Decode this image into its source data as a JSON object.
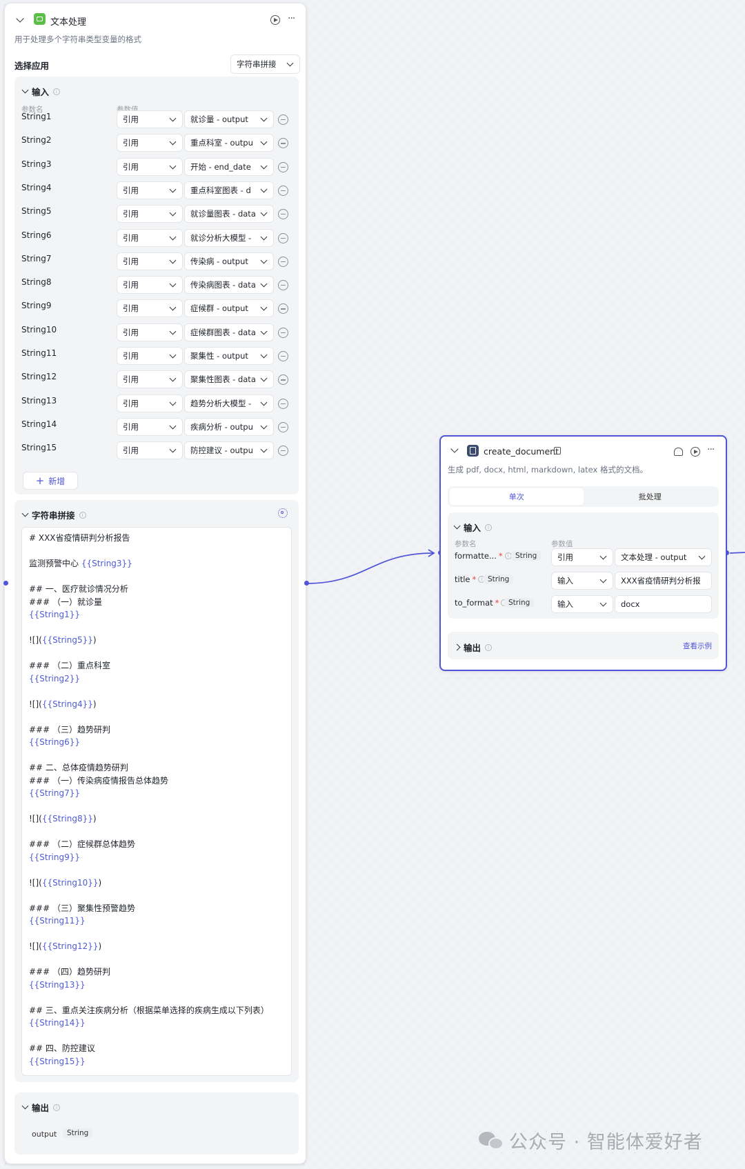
{
  "left_node": {
    "title": "文本处理",
    "description": "用于处理多个字符串类型变量的格式",
    "select_app_label": "选择应用",
    "select_app_value": "字符串拼接",
    "input_section": {
      "title": "输入",
      "col_param_name": "参数名",
      "col_param_value": "参数值",
      "rows": [
        {
          "name": "String1",
          "type": "引用",
          "value": "就诊量 - output"
        },
        {
          "name": "String2",
          "type": "引用",
          "value": "重点科室 - outpu"
        },
        {
          "name": "String3",
          "type": "引用",
          "value": "开始 - end_date"
        },
        {
          "name": "String4",
          "type": "引用",
          "value": "重点科室图表 - d"
        },
        {
          "name": "String5",
          "type": "引用",
          "value": "就诊量图表 - data"
        },
        {
          "name": "String6",
          "type": "引用",
          "value": "就诊分析大模型 -"
        },
        {
          "name": "String7",
          "type": "引用",
          "value": "传染病 - output"
        },
        {
          "name": "String8",
          "type": "引用",
          "value": "传染病图表 - data"
        },
        {
          "name": "String9",
          "type": "引用",
          "value": "症候群 - output"
        },
        {
          "name": "String10",
          "type": "引用",
          "value": "症候群图表 - data"
        },
        {
          "name": "String11",
          "type": "引用",
          "value": "聚集性 - output"
        },
        {
          "name": "String12",
          "type": "引用",
          "value": "聚集性图表 - data"
        },
        {
          "name": "String13",
          "type": "引用",
          "value": "趋势分析大模型 -"
        },
        {
          "name": "String14",
          "type": "引用",
          "value": "疾病分析 - outpu"
        },
        {
          "name": "String15",
          "type": "引用",
          "value": "防控建议 - outpu"
        }
      ],
      "add_label": "新增"
    },
    "concat_section": {
      "title": "字符串拼接",
      "lines": [
        {
          "t": "# XXX省疫情研判分析报告",
          "v": ""
        },
        {
          "t": "",
          "v": ""
        },
        {
          "t": "监测预警中心 ",
          "v": "{{String3}}"
        },
        {
          "t": "",
          "v": ""
        },
        {
          "t": "## 一、医疗就诊情况分析",
          "v": ""
        },
        {
          "t": "### （一）就诊量",
          "v": ""
        },
        {
          "t": "",
          "v": "{{String1}}"
        },
        {
          "t": "",
          "v": ""
        },
        {
          "t": "![](",
          "v": "{{String5}}",
          "after": ")"
        },
        {
          "t": "",
          "v": ""
        },
        {
          "t": "### （二）重点科室",
          "v": ""
        },
        {
          "t": "",
          "v": "{{String2}}"
        },
        {
          "t": "",
          "v": ""
        },
        {
          "t": "![](",
          "v": "{{String4}}",
          "after": ")"
        },
        {
          "t": "",
          "v": ""
        },
        {
          "t": "### （三）趋势研判",
          "v": ""
        },
        {
          "t": "",
          "v": "{{String6}}"
        },
        {
          "t": "",
          "v": ""
        },
        {
          "t": "## 二、总体疫情趋势研判",
          "v": ""
        },
        {
          "t": "### （一）传染病疫情报告总体趋势",
          "v": ""
        },
        {
          "t": "",
          "v": "{{String7}}"
        },
        {
          "t": "",
          "v": ""
        },
        {
          "t": "![](",
          "v": "{{String8}}",
          "after": ")"
        },
        {
          "t": "",
          "v": ""
        },
        {
          "t": "### （二）症候群总体趋势",
          "v": ""
        },
        {
          "t": "",
          "v": "{{String9}}"
        },
        {
          "t": "",
          "v": ""
        },
        {
          "t": "![](",
          "v": "{{String10}}",
          "after": ")"
        },
        {
          "t": "",
          "v": ""
        },
        {
          "t": "### （三）聚集性预警趋势",
          "v": ""
        },
        {
          "t": "",
          "v": "{{String11}}"
        },
        {
          "t": "",
          "v": ""
        },
        {
          "t": "![](",
          "v": "{{String12}}",
          "after": ")"
        },
        {
          "t": "",
          "v": ""
        },
        {
          "t": "### （四）趋势研判",
          "v": ""
        },
        {
          "t": "",
          "v": "{{String13}}"
        },
        {
          "t": "",
          "v": ""
        },
        {
          "t": "## 三、重点关注疾病分析（根据菜单选择的疾病生成以下列表）",
          "v": ""
        },
        {
          "t": "",
          "v": "{{String14}}"
        },
        {
          "t": "",
          "v": ""
        },
        {
          "t": "## 四、防控建议",
          "v": ""
        },
        {
          "t": "",
          "v": "{{String15}}"
        }
      ]
    },
    "output_section": {
      "title": "输出",
      "name": "output",
      "type": "String"
    }
  },
  "right_node": {
    "title": "create_document",
    "description": "生成 pdf, docx, html, markdown, latex 格式的文档。",
    "tabs": [
      "单次",
      "批处理"
    ],
    "input_title": "输入",
    "col_param_name": "参数名",
    "col_param_value": "参数值",
    "rows": [
      {
        "name": "formatte...",
        "required": "*",
        "type": "String",
        "mode": "引用",
        "value": "文本处理 - output"
      },
      {
        "name": "title",
        "required": "*",
        "type": "String",
        "mode": "输入",
        "value": "XXX省疫情研判分析报"
      },
      {
        "name": "to_format",
        "required": "*",
        "type": "String",
        "mode": "输入",
        "value": "docx"
      }
    ],
    "output_title": "输出",
    "view_example": "查看示例"
  },
  "watermark": "公众号 · 智能体爱好者",
  "colors": {
    "accent": "#4f55d9",
    "variable": "#4e5bd6",
    "node_icon": "#5bbf48"
  }
}
